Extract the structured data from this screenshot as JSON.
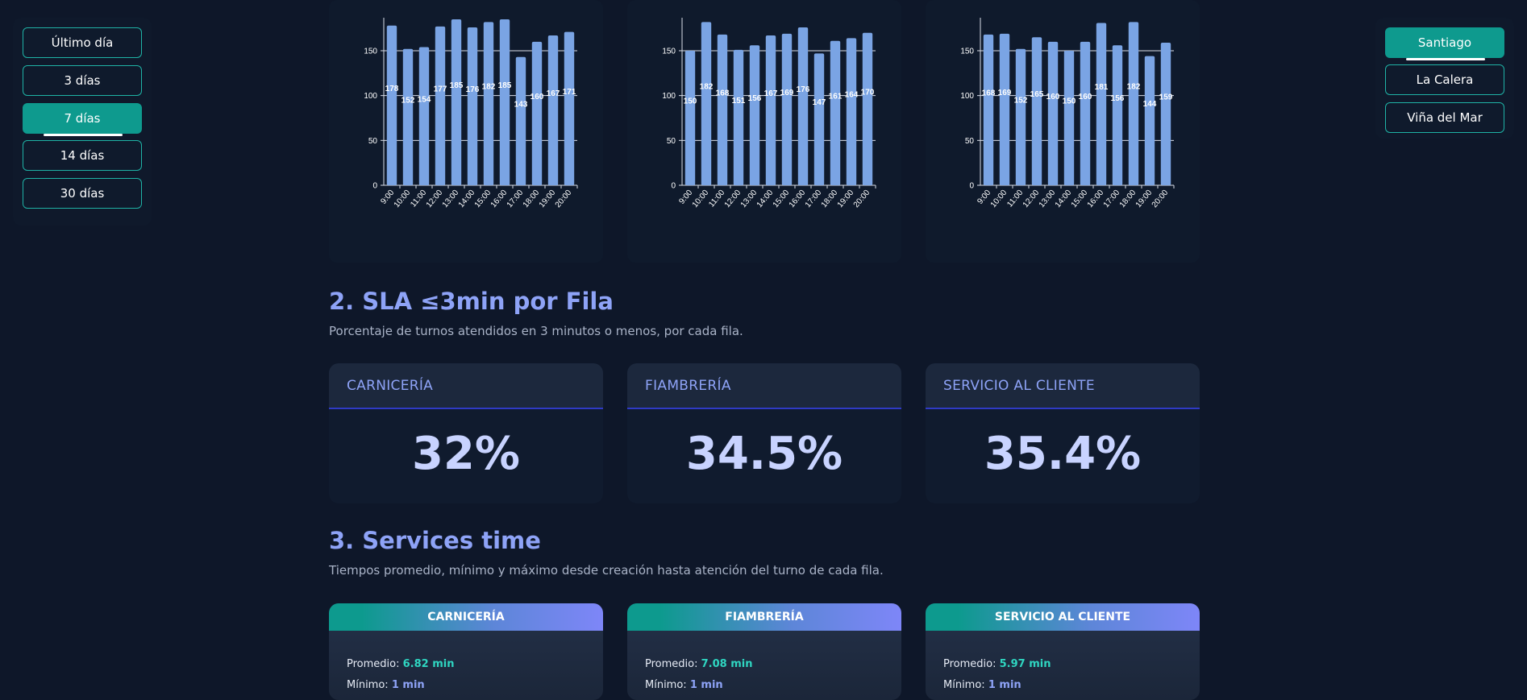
{
  "period_filter": {
    "options": [
      "Último día",
      "3 días",
      "7 días",
      "14 días",
      "30 días"
    ],
    "selected": "7 días"
  },
  "city_filter": {
    "options": [
      "Santiago",
      "La Calera",
      "Viña del Mar"
    ],
    "selected": "Santiago"
  },
  "colors": {
    "background": "#0e1729",
    "accent": "#0e9a8e",
    "bar": "#7aa4e4",
    "heading": "#8ea3f7",
    "value": "#c8d3ff"
  },
  "chart_data": [
    {
      "type": "bar",
      "categories": [
        "9:00",
        "10:00",
        "11:00",
        "12:00",
        "13:00",
        "14:00",
        "15:00",
        "16:00",
        "17:00",
        "18:00",
        "19:00",
        "20:00"
      ],
      "values": [
        178,
        152,
        154,
        177,
        185,
        176,
        182,
        185,
        143,
        160,
        167,
        171
      ],
      "ylim": [
        0,
        185
      ],
      "yticks": [
        0,
        50,
        100,
        150
      ],
      "grid": true,
      "data_labels": true
    },
    {
      "type": "bar",
      "categories": [
        "9:00",
        "10:00",
        "11:00",
        "12:00",
        "13:00",
        "14:00",
        "15:00",
        "16:00",
        "17:00",
        "18:00",
        "19:00",
        "20:00"
      ],
      "values": [
        150,
        182,
        168,
        151,
        156,
        167,
        169,
        176,
        147,
        161,
        164,
        170
      ],
      "ylim": [
        0,
        185
      ],
      "yticks": [
        0,
        50,
        100,
        150
      ],
      "grid": true,
      "data_labels": true
    },
    {
      "type": "bar",
      "categories": [
        "9:00",
        "10:00",
        "11:00",
        "12:00",
        "13:00",
        "14:00",
        "15:00",
        "16:00",
        "17:00",
        "18:00",
        "19:00",
        "20:00"
      ],
      "values": [
        168,
        169,
        152,
        165,
        160,
        150,
        160,
        181,
        156,
        182,
        144,
        159
      ],
      "ylim": [
        0,
        185
      ],
      "yticks": [
        0,
        50,
        100,
        150
      ],
      "grid": true,
      "data_labels": true
    }
  ],
  "sla_section": {
    "title": "2. SLA ≤3min por Fila",
    "description": "Porcentaje de turnos atendidos en 3 minutos o menos, por cada fila.",
    "cards": [
      {
        "label": "CARNICERÍA",
        "value": "32%"
      },
      {
        "label": "FIAMBRERÍA",
        "value": "34.5%"
      },
      {
        "label": "SERVICIO AL CLIENTE",
        "value": "35.4%"
      }
    ]
  },
  "services_section": {
    "title": "3. Services time",
    "description": "Tiempos promedio, mínimo y máximo desde creación hasta atención del turno de cada fila.",
    "cards": [
      {
        "label": "CARNICERÍA",
        "avg_label": "Promedio:",
        "avg": "6.82 min",
        "min_label": "Mínimo:",
        "min": "1 min"
      },
      {
        "label": "FIAMBRERÍA",
        "avg_label": "Promedio:",
        "avg": "7.08 min",
        "min_label": "Mínimo:",
        "min": "1 min"
      },
      {
        "label": "SERVICIO AL CLIENTE",
        "avg_label": "Promedio:",
        "avg": "5.97 min",
        "min_label": "Mínimo:",
        "min": "1 min"
      }
    ]
  }
}
